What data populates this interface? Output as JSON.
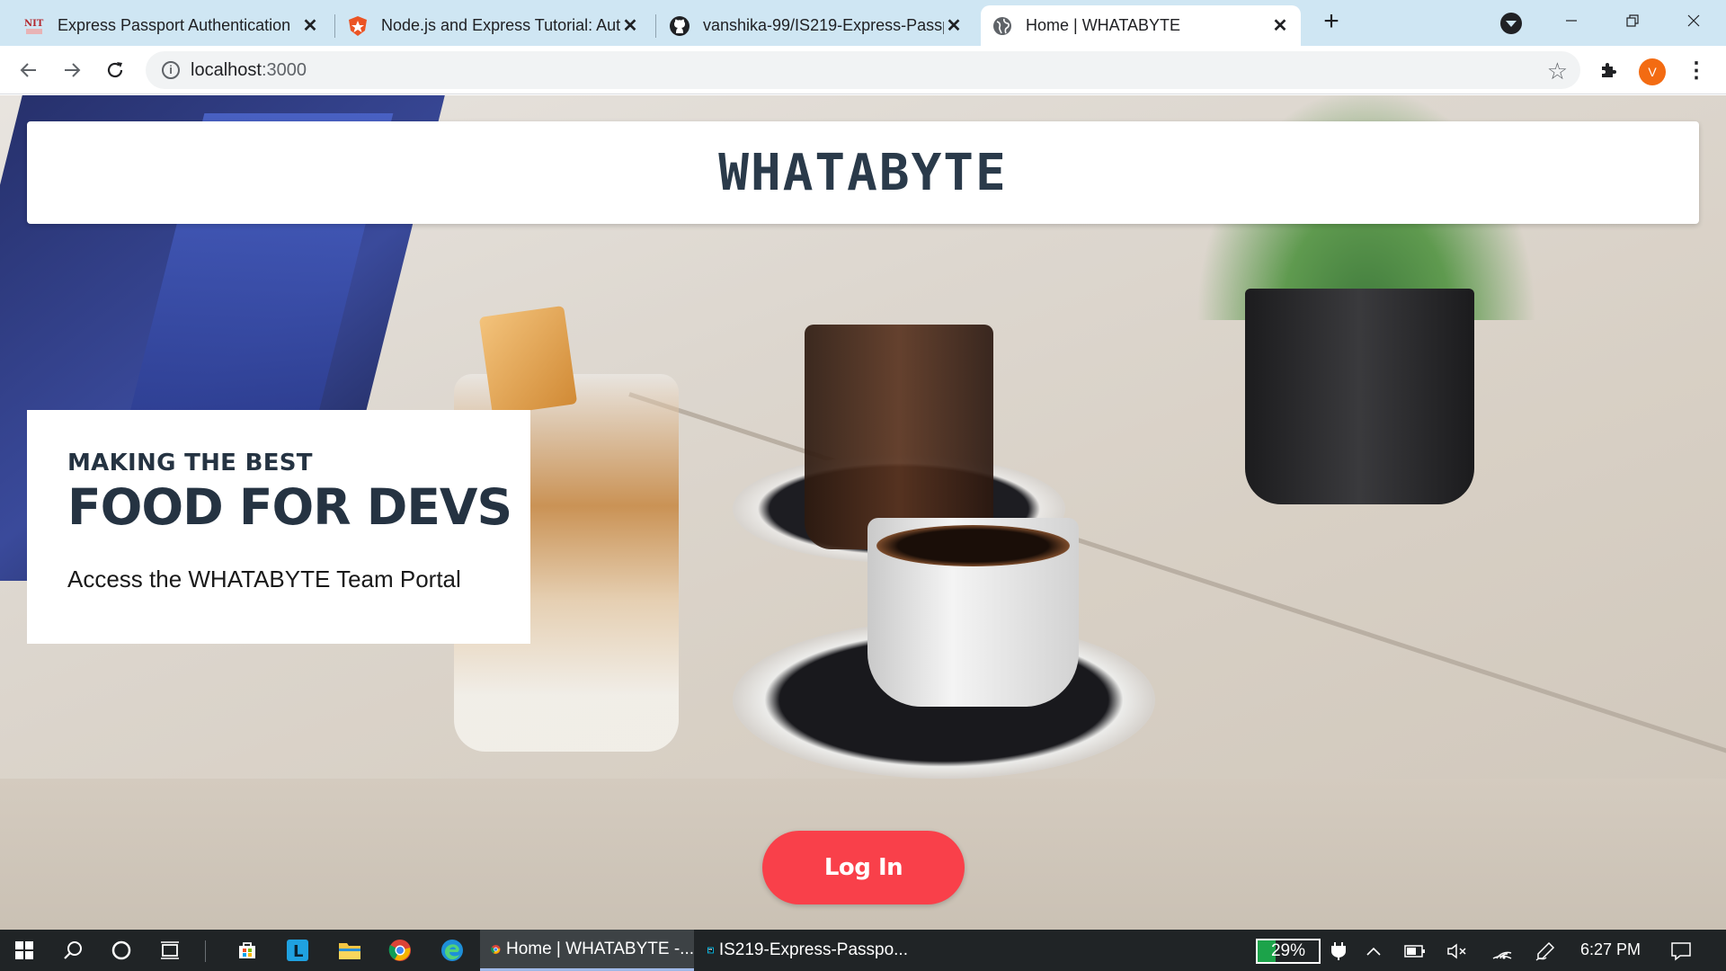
{
  "browser": {
    "tabs": [
      {
        "title": "Express Passport Authentication ",
        "icon": "nit-logo-icon",
        "active": false
      },
      {
        "title": "Node.js and Express Tutorial: Aut",
        "icon": "auth0-shield-icon",
        "active": false
      },
      {
        "title": "vanshika-99/IS219-Express-Passp",
        "icon": "github-icon",
        "active": false
      },
      {
        "title": "Home | WHATABYTE",
        "icon": "globe-icon",
        "active": true
      }
    ],
    "new_tab_icon": "plus-icon",
    "address": {
      "host": "localhost",
      "port": ":3000"
    },
    "profile_initial": "V",
    "profile_color": "#f36b12"
  },
  "page": {
    "brand": "WHATABYTE",
    "hero": {
      "subtitle": "MAKING THE BEST",
      "title": "FOOD FOR DEVS",
      "description": "Access the WHATABYTE Team Portal"
    },
    "login_label": "Log In",
    "accent_color": "#f9404a",
    "text_color": "#253342"
  },
  "taskbar": {
    "apps": [
      {
        "label": "Home | WHATABYTE -...",
        "icon": "chrome-icon",
        "active": true
      },
      {
        "label": "IS219-Express-Passpo...",
        "icon": "webstorm-icon",
        "active": false
      }
    ],
    "battery_label": "29%",
    "battery_level": 0.29,
    "time": "6:27 PM"
  }
}
